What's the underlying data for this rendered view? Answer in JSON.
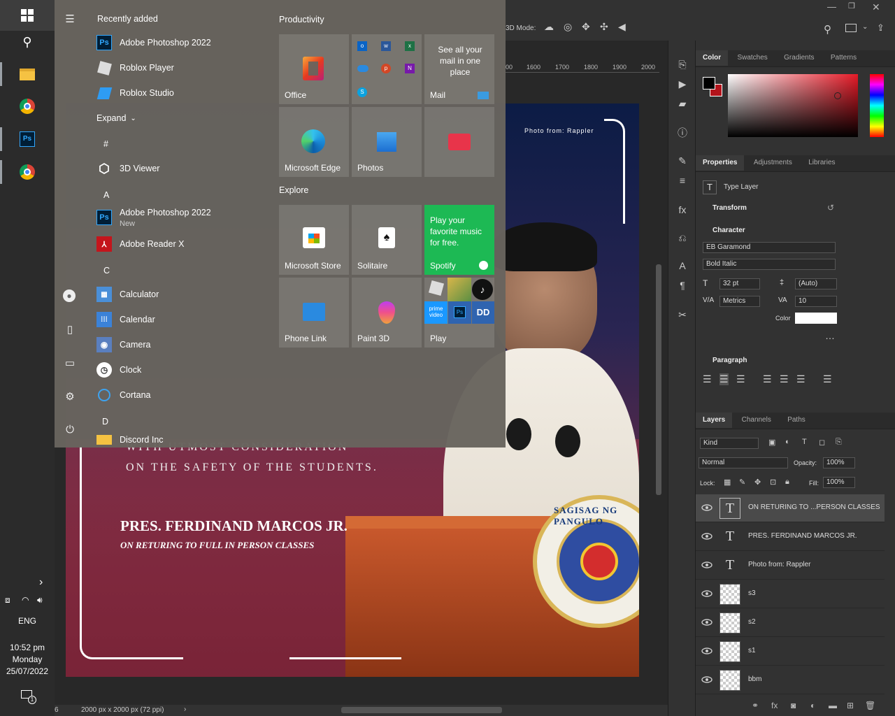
{
  "taskbar": {
    "language": "ENG",
    "time": "10:52 pm",
    "day": "Monday",
    "date": "25/07/2022",
    "notification_count": "1"
  },
  "start_menu": {
    "recently_added_header": "Recently added",
    "recent_apps": [
      "Adobe Photoshop 2022",
      "Roblox Player",
      "Roblox Studio"
    ],
    "expand_label": "Expand",
    "group_hash": "#",
    "app_3d_viewer": "3D Viewer",
    "group_a": "A",
    "app_photoshop": "Adobe Photoshop 2022",
    "app_photoshop_badge": "New",
    "app_reader": "Adobe Reader X",
    "group_c": "C",
    "apps_c": [
      "Calculator",
      "Calendar",
      "Camera",
      "Clock",
      "Cortana"
    ],
    "group_d": "D",
    "app_discord": "Discord Inc",
    "productivity_header": "Productivity",
    "explore_header": "Explore",
    "tiles": {
      "office": "Office",
      "mail_desc": "See all your mail in one place",
      "mail": "Mail",
      "edge": "Microsoft Edge",
      "photos": "Photos",
      "store": "Microsoft Store",
      "solitaire": "Solitaire",
      "spotify_desc": "Play your favorite music for free.",
      "spotify": "Spotify",
      "phone_link": "Phone Link",
      "paint3d": "Paint 3D",
      "play": "Play",
      "prime_video": "prime video",
      "ps": "Ps"
    }
  },
  "photoshop": {
    "mode_label": "3D Mode:",
    "ruler_ticks": [
      "00",
      "1600",
      "1700",
      "1800",
      "1900",
      "2000"
    ],
    "status": "2000 px x 2000 px (72 ppi)",
    "zoom_fragment": "6",
    "color_tabs": [
      "Color",
      "Swatches",
      "Gradients",
      "Patterns"
    ],
    "properties_tabs": [
      "Properties",
      "Adjustments",
      "Libraries"
    ],
    "type_layer": "Type Layer",
    "transform": "Transform",
    "character": "Character",
    "font_family": "EB Garamond",
    "font_style": "Bold Italic",
    "font_size": "32 pt",
    "leading": "(Auto)",
    "kerning": "Metrics",
    "tracking": "10",
    "color_label": "Color",
    "paragraph": "Paragraph",
    "layers_tabs": [
      "Layers",
      "Channels",
      "Paths"
    ],
    "kind_label": "Kind",
    "blend_mode": "Normal",
    "opacity_label": "Opacity:",
    "opacity": "100%",
    "lock_label": "Lock:",
    "fill_label": "Fill:",
    "fill": "100%",
    "layers": [
      {
        "name": "ON RETURING TO ...PERSON CLASSES",
        "type": "text"
      },
      {
        "name": "PRES. FERDINAND MARCOS JR.",
        "type": "text"
      },
      {
        "name": "Photo from: Rappler",
        "type": "text"
      },
      {
        "name": "s3",
        "type": "smart"
      },
      {
        "name": "s2",
        "type": "smart"
      },
      {
        "name": "s1",
        "type": "smart"
      },
      {
        "name": "bbm",
        "type": "smart"
      }
    ]
  },
  "artwork": {
    "credit": "Photo from: Rappler",
    "line1": "WITH UTMOST CONSIDERATION",
    "line2": "ON THE SAFETY OF THE STUDENTS.",
    "name": "PRES. FERDINAND MARCOS JR.",
    "subtitle": "ON RETURING TO FULL IN PERSON CLASSES",
    "seal_text": "SAGISAG NG PANGULO"
  },
  "colors": {
    "accent_spotify": "#1db954",
    "foreground_swatch": "#000000",
    "background_swatch": "#b3141c"
  }
}
